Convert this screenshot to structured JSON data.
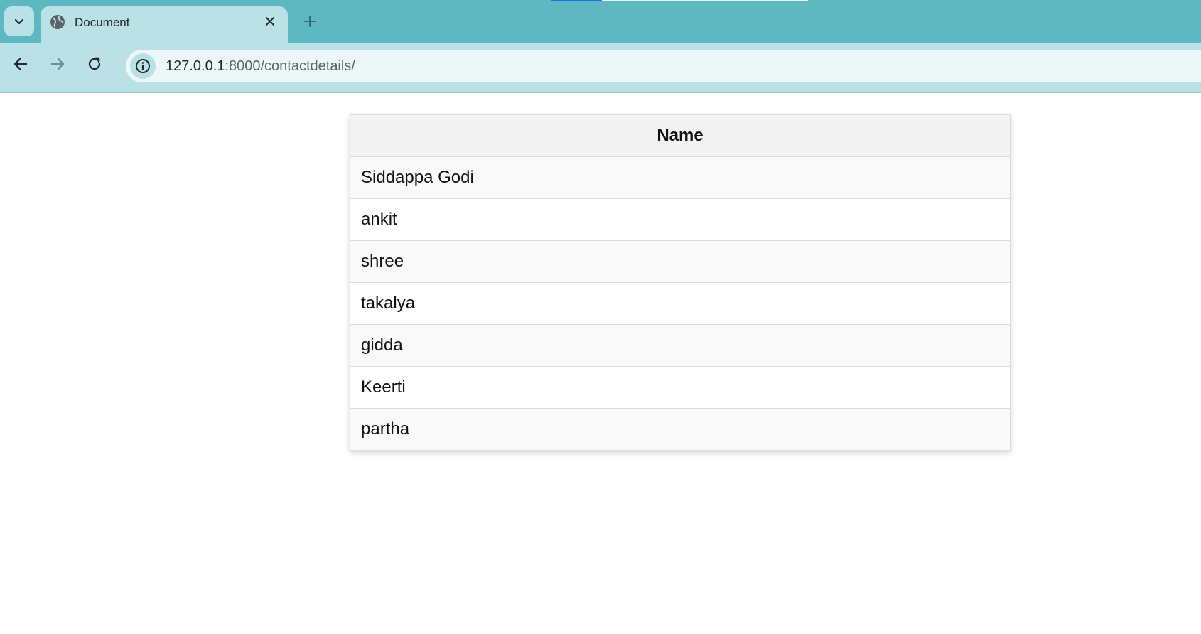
{
  "browser": {
    "tab": {
      "title": "Document",
      "close_glyph": "✕"
    },
    "new_tab_glyph": "+",
    "address": {
      "host": "127.0.0.1",
      "path": ":8000/contactdetails/"
    },
    "colors": {
      "frame": "#5db8c2",
      "toolbar": "#b9e1e6",
      "omnibox": "#eef7f8",
      "loading_bar": "#1a73e8"
    }
  },
  "table": {
    "header": "Name",
    "rows": [
      "Siddappa Godi",
      "ankit",
      "shree",
      "takalya",
      "gidda",
      "Keerti",
      "partha"
    ]
  }
}
